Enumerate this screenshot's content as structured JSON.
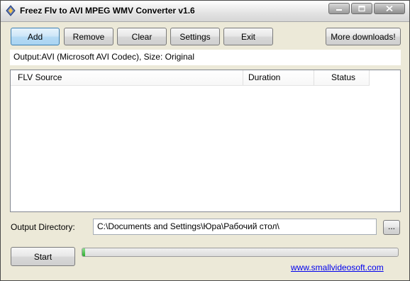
{
  "window": {
    "title": "Freez Flv to AVI MPEG WMV Converter v1.6"
  },
  "toolbar": {
    "add_label": "Add",
    "remove_label": "Remove",
    "clear_label": "Clear",
    "settings_label": "Settings",
    "exit_label": "Exit",
    "more_downloads_label": "More downloads!"
  },
  "output_info": "Output:AVI (Microsoft AVI Codec), Size: Original",
  "file_list": {
    "columns": [
      "FLV Source",
      "Duration",
      "Status"
    ],
    "rows": []
  },
  "output_directory": {
    "label": "Output Directory:",
    "value": "C:\\Documents and Settings\\Юра\\Рабочий стол\\",
    "browse_label": "..."
  },
  "start_label": "Start",
  "progress": {
    "value": 0.01
  },
  "website_link": "www.smallvideosoft.com",
  "colors": {
    "window_bg": "#ece9d8",
    "default_button": "#a9d4f2",
    "progress_fill": "#2fae2f",
    "link": "#0000ee"
  }
}
